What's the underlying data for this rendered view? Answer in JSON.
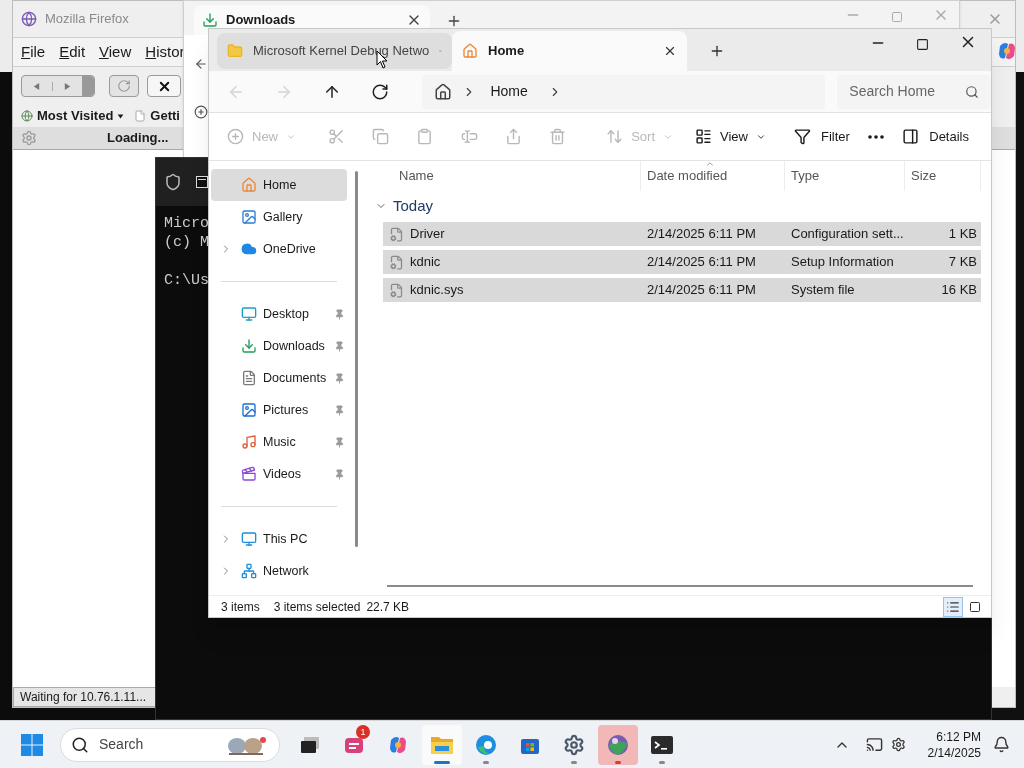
{
  "firefox": {
    "title": "Mozilla Firefox",
    "menu": [
      "File",
      "Edit",
      "View",
      "Histor"
    ],
    "bookmarks": [
      {
        "label": "Most Visited",
        "kind": "folder"
      },
      {
        "label": "Getti",
        "kind": "page"
      }
    ],
    "progress": "Loading...",
    "status": "Waiting for 10.76.1.11..."
  },
  "downloads_window": {
    "tab": "Downloads"
  },
  "terminal": {
    "lines": [
      "Micro",
      "(c) M"
    ],
    "prompt": "C:\\Us"
  },
  "explorer": {
    "tabs": [
      {
        "label": "Microsoft Kernel Debug Netwo",
        "selected": false
      },
      {
        "label": "Home",
        "selected": true
      }
    ],
    "nav": [
      {
        "disabled": true
      },
      {
        "disabled": true
      },
      {
        "disabled": false
      },
      {
        "disabled": false
      }
    ],
    "breadcrumb": [
      "Home"
    ],
    "search": {
      "placeholder": "Search Home"
    },
    "commands": [
      {
        "kind": "menu",
        "label": "New",
        "disabled": true
      },
      {
        "kind": "icon",
        "disabled": true
      },
      {
        "kind": "icon",
        "disabled": true
      },
      {
        "kind": "icon",
        "disabled": true
      },
      {
        "kind": "icon",
        "disabled": true
      },
      {
        "kind": "icon",
        "disabled": true
      },
      {
        "kind": "icon",
        "disabled": true
      },
      {
        "kind": "menu",
        "label": "Sort",
        "disabled": true
      },
      {
        "kind": "menu",
        "label": "View",
        "disabled": false
      },
      {
        "kind": "button",
        "label": "Filter",
        "disabled": false
      },
      {
        "kind": "icon",
        "disabled": false
      },
      {
        "kind": "pane",
        "label": "Details",
        "disabled": false
      }
    ],
    "sidebar": [
      {
        "items": [
          {
            "label": "Home",
            "selected": true,
            "expandable": false,
            "pinned": false
          },
          {
            "label": "Gallery",
            "selected": false,
            "expandable": false,
            "pinned": false
          },
          {
            "label": "OneDrive",
            "selected": false,
            "expandable": true,
            "pinned": false
          }
        ]
      },
      {
        "items": [
          {
            "label": "Desktop",
            "selected": false,
            "expandable": false,
            "pinned": true
          },
          {
            "label": "Downloads",
            "selected": false,
            "expandable": false,
            "pinned": true
          },
          {
            "label": "Documents",
            "selected": false,
            "expandable": false,
            "pinned": true
          },
          {
            "label": "Pictures",
            "selected": false,
            "expandable": false,
            "pinned": true
          },
          {
            "label": "Music",
            "selected": false,
            "expandable": false,
            "pinned": true
          },
          {
            "label": "Videos",
            "selected": false,
            "expandable": false,
            "pinned": true
          }
        ]
      },
      {
        "items": [
          {
            "label": "This PC",
            "selected": false,
            "expandable": true,
            "pinned": false
          },
          {
            "label": "Network",
            "selected": false,
            "expandable": true,
            "pinned": false
          }
        ]
      }
    ],
    "columns": [
      {
        "label": "Name",
        "sorted": false
      },
      {
        "label": "Date modified",
        "sorted": true
      },
      {
        "label": "Type",
        "sorted": false
      },
      {
        "label": "Size",
        "sorted": false
      }
    ],
    "group": {
      "label": "Today",
      "expanded": true
    },
    "rows": [
      {
        "name": "Driver",
        "date": "2/14/2025 6:11 PM",
        "type": "Configuration sett...",
        "size": "1 KB",
        "selected": true
      },
      {
        "name": "kdnic",
        "date": "2/14/2025 6:11 PM",
        "type": "Setup Information",
        "size": "7 KB",
        "selected": true
      },
      {
        "name": "kdnic.sys",
        "date": "2/14/2025 6:11 PM",
        "type": "System file",
        "size": "16 KB",
        "selected": true
      }
    ],
    "status": {
      "count": "3 items",
      "selection": "3 items selected",
      "size": "22.7 KB"
    },
    "views": [
      {
        "kind": "details",
        "selected": true
      },
      {
        "kind": "tiles",
        "selected": false
      }
    ]
  },
  "taskbar": {
    "search": {
      "placeholder": "Search"
    },
    "apps": [
      {
        "selected": false,
        "running": false,
        "alert": false
      },
      {
        "selected": false,
        "running": false,
        "alert": false,
        "badge": "1"
      },
      {
        "selected": false,
        "running": false,
        "alert": false
      },
      {
        "selected": true,
        "running": true,
        "alert": false
      },
      {
        "selected": false,
        "running": true,
        "alert": false
      },
      {
        "selected": false,
        "running": false,
        "alert": false
      },
      {
        "selected": false,
        "running": true,
        "alert": false
      },
      {
        "selected": false,
        "running": true,
        "alert": true
      },
      {
        "selected": false,
        "running": true,
        "alert": false
      }
    ],
    "time": "6:12 PM",
    "date": "2/14/2025"
  }
}
